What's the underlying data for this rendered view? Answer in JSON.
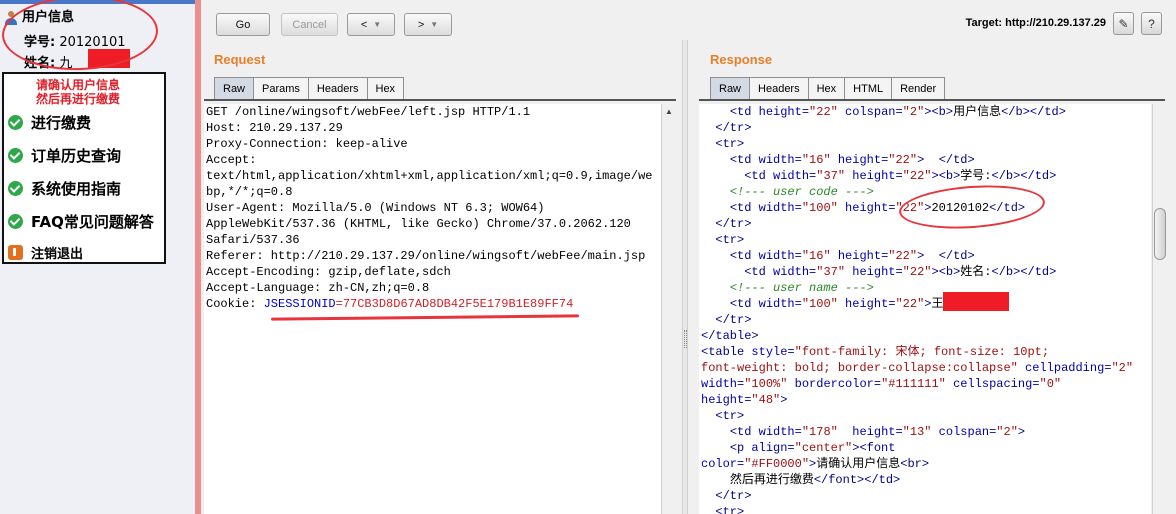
{
  "left_panel": {
    "header": "用户信息",
    "student_id_label": "学号:",
    "student_id_value": "20120101",
    "name_label": "姓名:",
    "name_value": "九",
    "confirm_notice": [
      "请确认用户信息",
      "然后再进行缴费"
    ],
    "menu": [
      {
        "label": "进行缴费",
        "icon": "green-check-icon"
      },
      {
        "label": "订单历史查询",
        "icon": "green-check-icon"
      },
      {
        "label": "系统使用指南",
        "icon": "green-check-icon"
      },
      {
        "label": "FAQ常见问题解答",
        "icon": "green-check-icon"
      },
      {
        "label": "注销退出",
        "icon": "exit-icon"
      }
    ]
  },
  "toolbar": {
    "go_label": "Go",
    "cancel_label": "Cancel",
    "back_label": "<",
    "forward_label": ">",
    "target_label": "Target: http://210.29.137.29"
  },
  "request": {
    "title": "Request",
    "tabs": [
      "Raw",
      "Params",
      "Headers",
      "Hex"
    ],
    "lines": [
      "GET /online/wingsoft/webFee/left.jsp HTTP/1.1",
      "Host: 210.29.137.29",
      "Proxy-Connection: keep-alive",
      "Accept:",
      "text/html,application/xhtml+xml,application/xml;q=0.9,image/we",
      "bp,*/*;q=0.8",
      "User-Agent: Mozilla/5.0 (Windows NT 6.3; WOW64)",
      "AppleWebKit/537.36 (KHTML, like Gecko) Chrome/37.0.2062.120",
      "Safari/537.36",
      "Referer: http://210.29.137.29/online/wingsoft/webFee/main.jsp",
      "Accept-Encoding: gzip,deflate,sdch",
      "Accept-Language: zh-CN,zh;q=0.8"
    ],
    "cookie_prefix": "Cookie: ",
    "cookie_key": "JSESSIONID",
    "cookie_eq": "=",
    "cookie_value": "77CB3D8D67AD8DB42F5E179B1E89FF74"
  },
  "response": {
    "title": "Response",
    "tabs": [
      "Raw",
      "Headers",
      "Hex",
      "HTML",
      "Render"
    ],
    "lines": [
      [
        [
          "    ",
          "txt"
        ],
        [
          "<td ",
          "tag"
        ],
        [
          "height=",
          "attr"
        ],
        [
          "\"22\"",
          "val"
        ],
        [
          " colspan=",
          "attr"
        ],
        [
          "\"2\"",
          "val"
        ],
        [
          ">",
          "tag"
        ],
        [
          "<b>",
          "tag"
        ],
        [
          "用户信息",
          "txt"
        ],
        [
          "</b>",
          "tag"
        ],
        [
          "</td>",
          "tag"
        ]
      ],
      [
        [
          "  ",
          "txt"
        ],
        [
          "</tr>",
          "tag"
        ]
      ],
      [
        [
          "  ",
          "txt"
        ],
        [
          "<tr>",
          "tag"
        ]
      ],
      [
        [
          "    ",
          "txt"
        ],
        [
          "<td ",
          "tag"
        ],
        [
          "width=",
          "attr"
        ],
        [
          "\"16\"",
          "val"
        ],
        [
          " height=",
          "attr"
        ],
        [
          "\"22\"",
          "val"
        ],
        [
          ">  ",
          "tag"
        ],
        [
          "</td>",
          "tag"
        ]
      ],
      [
        [
          "      ",
          "txt"
        ],
        [
          "<td ",
          "tag"
        ],
        [
          "width=",
          "attr"
        ],
        [
          "\"37\"",
          "val"
        ],
        [
          " height=",
          "attr"
        ],
        [
          "\"22\"",
          "val"
        ],
        [
          ">",
          "tag"
        ],
        [
          "<b>",
          "tag"
        ],
        [
          "学号:",
          "txt"
        ],
        [
          "</b>",
          "tag"
        ],
        [
          "</td>",
          "tag"
        ]
      ],
      [
        [
          "    ",
          "txt"
        ],
        [
          "<!--- user code --->",
          "cmt"
        ]
      ],
      [
        [
          "    ",
          "txt"
        ],
        [
          "<td ",
          "tag"
        ],
        [
          "width=",
          "attr"
        ],
        [
          "\"100\"",
          "val"
        ],
        [
          " height=",
          "attr"
        ],
        [
          "\"22\"",
          "val"
        ],
        [
          ">",
          "tag"
        ],
        [
          "20120102",
          "txt"
        ],
        [
          "</td>",
          "tag"
        ]
      ],
      [
        [
          "  ",
          "txt"
        ],
        [
          "</tr>",
          "tag"
        ]
      ],
      [
        [
          "  ",
          "txt"
        ],
        [
          "<tr>",
          "tag"
        ]
      ],
      [
        [
          "    ",
          "txt"
        ],
        [
          "<td ",
          "tag"
        ],
        [
          "width=",
          "attr"
        ],
        [
          "\"16\"",
          "val"
        ],
        [
          " height=",
          "attr"
        ],
        [
          "\"22\"",
          "val"
        ],
        [
          ">  ",
          "tag"
        ],
        [
          "</td>",
          "tag"
        ]
      ],
      [
        [
          "      ",
          "txt"
        ],
        [
          "<td ",
          "tag"
        ],
        [
          "width=",
          "attr"
        ],
        [
          "\"37\"",
          "val"
        ],
        [
          " height=",
          "attr"
        ],
        [
          "\"22\"",
          "val"
        ],
        [
          ">",
          "tag"
        ],
        [
          "<b>",
          "tag"
        ],
        [
          "姓名:",
          "txt"
        ],
        [
          "</b>",
          "tag"
        ],
        [
          "</td>",
          "tag"
        ]
      ],
      [
        [
          "    ",
          "txt"
        ],
        [
          "<!--- user name --->",
          "cmt"
        ]
      ],
      [
        [
          "    ",
          "txt"
        ],
        [
          "<td ",
          "tag"
        ],
        [
          "width=",
          "attr"
        ],
        [
          "\"100\"",
          "val"
        ],
        [
          " height=",
          "attr"
        ],
        [
          "\"22\"",
          "val"
        ],
        [
          ">",
          "tag"
        ],
        [
          "王",
          "txt"
        ]
      ],
      [
        [
          "  ",
          "txt"
        ],
        [
          "</tr>",
          "tag"
        ]
      ],
      [
        [
          "</table>",
          "tag"
        ]
      ],
      [
        [
          "<table ",
          "tag"
        ],
        [
          "style=",
          "attr"
        ],
        [
          "\"font-family: 宋体; font-size: 10pt;",
          "val"
        ]
      ],
      [
        [
          "font-weight: bold; border-collapse:collapse\"",
          "val"
        ],
        [
          " cellpadding=",
          "attr"
        ],
        [
          "\"2\"",
          "val"
        ]
      ],
      [
        [
          "width=",
          "attr"
        ],
        [
          "\"100%\"",
          "val"
        ],
        [
          " bordercolor=",
          "attr"
        ],
        [
          "\"#111111\"",
          "val"
        ],
        [
          " cellspacing=",
          "attr"
        ],
        [
          "\"0\"",
          "val"
        ]
      ],
      [
        [
          "height=",
          "attr"
        ],
        [
          "\"48\"",
          "val"
        ],
        [
          ">",
          "tag"
        ]
      ],
      [
        [
          "  ",
          "txt"
        ],
        [
          "<tr>",
          "tag"
        ]
      ],
      [
        [
          "    ",
          "txt"
        ],
        [
          "<td ",
          "tag"
        ],
        [
          "width=",
          "attr"
        ],
        [
          "\"178\"",
          "val"
        ],
        [
          "  height=",
          "attr"
        ],
        [
          "\"13\"",
          "val"
        ],
        [
          " colspan=",
          "attr"
        ],
        [
          "\"2\"",
          "val"
        ],
        [
          ">",
          "tag"
        ]
      ],
      [
        [
          "    ",
          "txt"
        ],
        [
          "<p ",
          "tag"
        ],
        [
          "align=",
          "attr"
        ],
        [
          "\"center\"",
          "val"
        ],
        [
          ">",
          "tag"
        ],
        [
          "<font",
          "tag"
        ]
      ],
      [
        [
          "color=",
          "attr"
        ],
        [
          "\"#FF0000\"",
          "val"
        ],
        [
          ">",
          "tag"
        ],
        [
          "请确认用户信息",
          "txt"
        ],
        [
          "<br>",
          "tag"
        ]
      ],
      [
        [
          "    ",
          "txt"
        ],
        [
          "然后再进行缴费",
          "txt"
        ],
        [
          "</font>",
          "tag"
        ],
        [
          "</td>",
          "tag"
        ]
      ],
      [
        [
          "  ",
          "txt"
        ],
        [
          "</tr>",
          "tag"
        ]
      ],
      [
        [
          "  ",
          "txt"
        ],
        [
          "<tr>",
          "tag"
        ]
      ]
    ]
  }
}
